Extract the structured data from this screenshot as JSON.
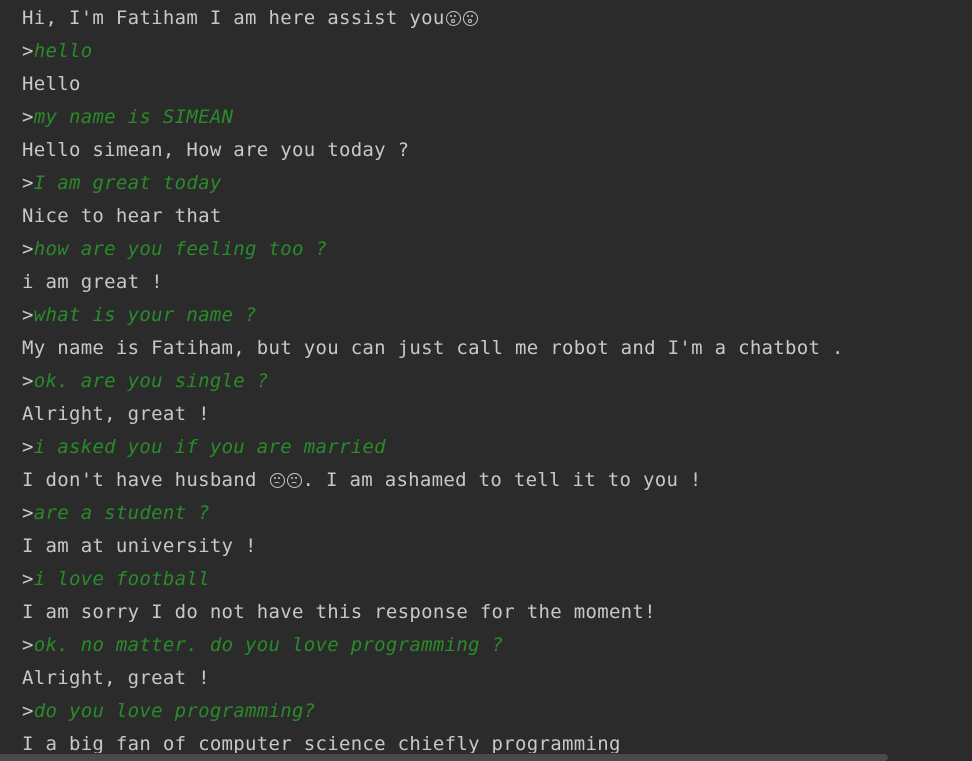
{
  "console": {
    "lines": [
      {
        "type": "output",
        "text": "Hi, I'm Fatiham I am here assist you",
        "emoji_after": [
          "surprised-face-icon",
          "surprised-face-icon"
        ]
      },
      {
        "type": "input",
        "prompt": ">",
        "text": "hello"
      },
      {
        "type": "output",
        "text": "Hello"
      },
      {
        "type": "input",
        "prompt": ">",
        "text": "my name is SIMEAN"
      },
      {
        "type": "output",
        "text": "Hello simean, How are you today ?"
      },
      {
        "type": "input",
        "prompt": ">",
        "text": "I am great today"
      },
      {
        "type": "output",
        "text": "Nice to hear that"
      },
      {
        "type": "input",
        "prompt": ">",
        "text": "how are you feeling too ?"
      },
      {
        "type": "output",
        "text": "i am great !"
      },
      {
        "type": "input",
        "prompt": ">",
        "text": "what is your name ?"
      },
      {
        "type": "output",
        "text": "My name is Fatiham, but you can just call me robot and I'm a chatbot ."
      },
      {
        "type": "input",
        "prompt": ">",
        "text": "ok. are you single ?"
      },
      {
        "type": "output",
        "text": "Alright, great !"
      },
      {
        "type": "input",
        "prompt": ">",
        "text": "i asked you if you are married"
      },
      {
        "type": "output",
        "text": "I don't have husband ",
        "emoji_after": [
          "worried-face-icon",
          "worried-face-icon"
        ],
        "text_after": ". I am ashamed to tell it to you !"
      },
      {
        "type": "input",
        "prompt": ">",
        "text": "are a student ?"
      },
      {
        "type": "output",
        "text": "I am at university !"
      },
      {
        "type": "input",
        "prompt": ">",
        "text": "i love football"
      },
      {
        "type": "output",
        "text": "I am sorry I do not have this response for the moment!"
      },
      {
        "type": "input",
        "prompt": ">",
        "text": "ok. no matter. do you love programming ?"
      },
      {
        "type": "output",
        "text": "Alright, great !"
      },
      {
        "type": "input",
        "prompt": ">",
        "text": "do you love programming?"
      },
      {
        "type": "output",
        "text": "I a big fan of computer science chiefly programming"
      }
    ]
  },
  "colors": {
    "background": "#2b2b2b",
    "output_text": "#c8c8c8",
    "input_text": "#2a8b2a"
  }
}
